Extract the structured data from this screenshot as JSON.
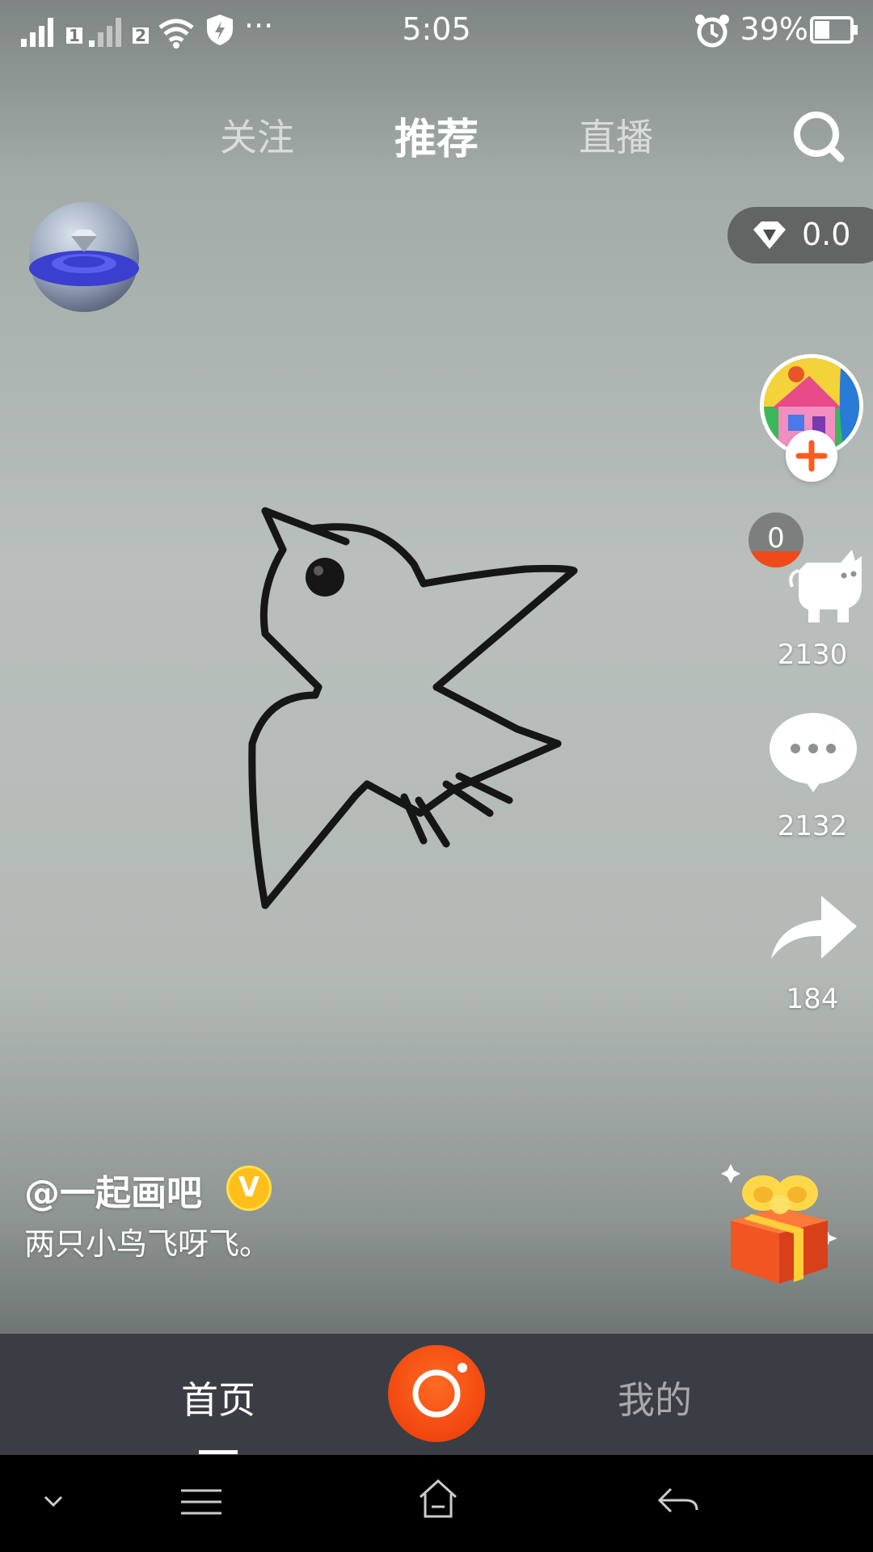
{
  "status_bar": {
    "time": "5:05",
    "battery_percent": "39%",
    "sim1": "1",
    "sim2": "2",
    "more": "···"
  },
  "top_nav": {
    "tabs": [
      {
        "label": "关注",
        "active": false
      },
      {
        "label": "推荐",
        "active": true
      },
      {
        "label": "直播",
        "active": false
      }
    ]
  },
  "diamond": {
    "value": "0.0"
  },
  "rail": {
    "like_count": "2130",
    "comment_count": "2132",
    "share_count": "184",
    "badge_count": "0"
  },
  "caption": {
    "user": "@一起画吧",
    "verified_mark": "V",
    "text": "两只小鸟飞呀飞。"
  },
  "app_nav": {
    "home_label": "首页",
    "me_label": "我的"
  },
  "colors": {
    "accent": "#f2470e",
    "nav_bg": "#3a3e44",
    "verified": "#ffbf1a"
  },
  "icons": [
    "signal-icon",
    "wifi-icon",
    "shield-icon",
    "alarm-icon",
    "battery-icon",
    "search-icon",
    "diamond-icon",
    "plus-icon",
    "like-icon",
    "comment-icon",
    "share-icon",
    "gift-icon",
    "record-icon",
    "chevron-down-icon",
    "menu-icon",
    "home-icon",
    "back-icon"
  ]
}
